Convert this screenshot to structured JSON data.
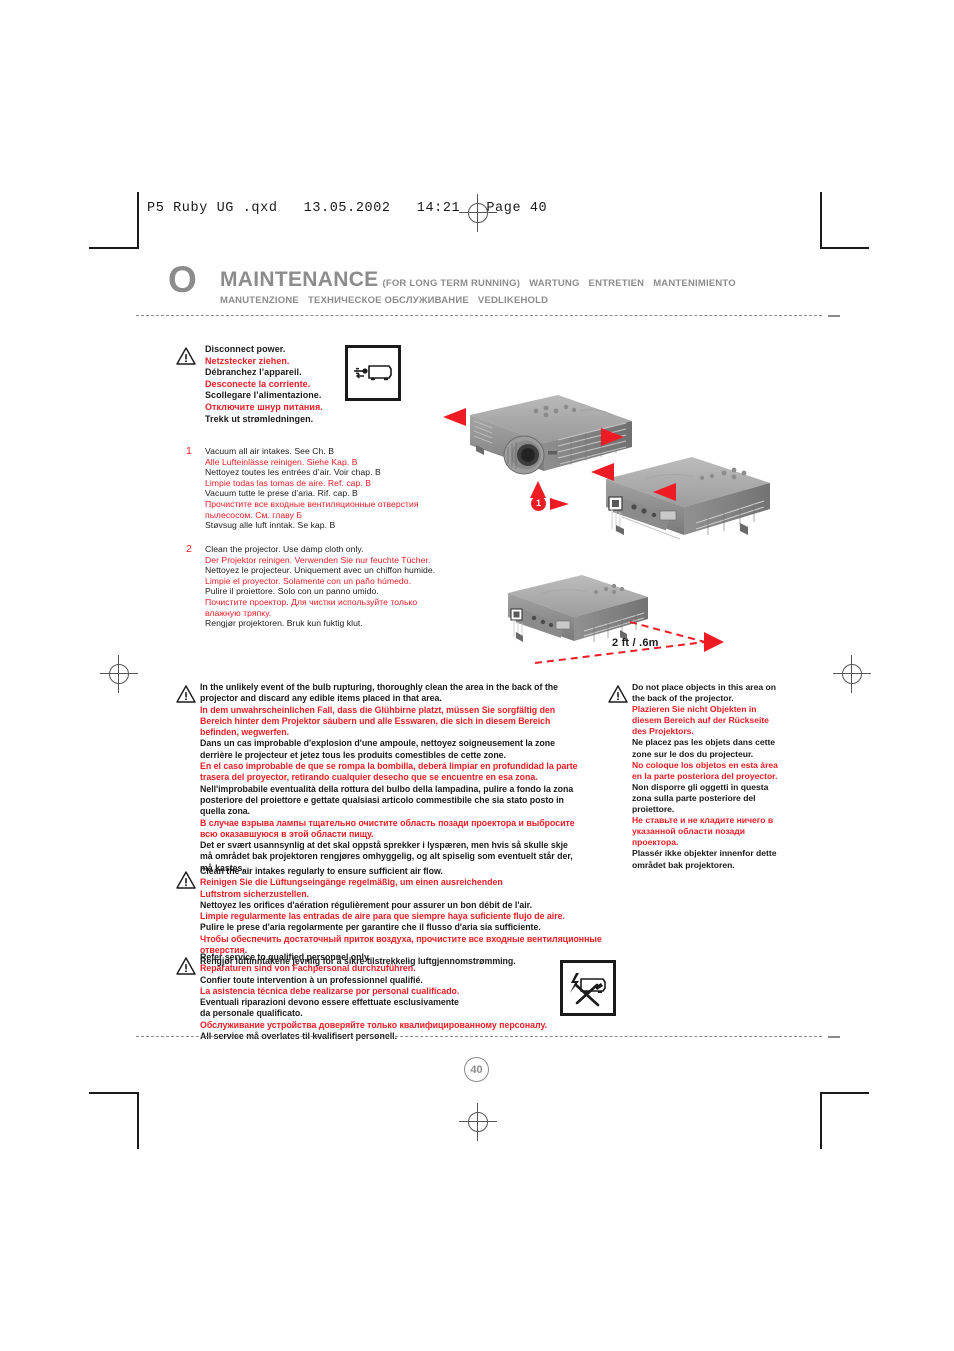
{
  "meta": {
    "slug": "P5 Ruby UG .qxd   13.05.2002   14:21   Page 40",
    "page_number": "40"
  },
  "header": {
    "section_letter": "O",
    "title": "MAINTENANCE",
    "title_paren": "(FOR LONG TERM RUNNING)",
    "langs_line1": [
      "WARTUNG",
      "ENTRETIEN",
      "MANTENIMIENTO"
    ],
    "langs_line2": [
      "MANUTENZIONE",
      "ТЕХНИЧЕСКОЕ ОБСЛУЖИВАНИЕ",
      "VEDLIKEHOLD"
    ]
  },
  "colors": {
    "red": "#ed1c24",
    "grey": "#8c8c8c",
    "black": "#1a1a1a"
  },
  "disconnect": {
    "icon": "unplug-power-icon",
    "lines": [
      {
        "text": "Disconnect power.",
        "red": false
      },
      {
        "text": "Netzstecker ziehen.",
        "red": true
      },
      {
        "text": "Débranchez l’appareil.",
        "red": false
      },
      {
        "text": "Desconecte la corriente.",
        "red": true
      },
      {
        "text": "Scollegare l’alimentazione.",
        "red": false
      },
      {
        "text": "Отключите шнур питания.",
        "red": true
      },
      {
        "text": "Trekk ut strømledningen.",
        "red": false
      }
    ]
  },
  "steps": [
    {
      "num": "1",
      "lines": [
        {
          "text": "Vacuum all air intakes. See Ch. B",
          "red": false
        },
        {
          "text": "Alle Lufteinlässe reinigen. Siehe Kap. B",
          "red": true
        },
        {
          "text": "Nettoyez toutes les entrées d’air. Voir chap. B",
          "red": false
        },
        {
          "text": "Limpie todas las tomas de aire. Ref. cap. B",
          "red": true
        },
        {
          "text": "Vacuum tutte le prese d’aria. Rif. cap. B",
          "red": false
        },
        {
          "text": "Прочистите все входные вентиляционные отверстия",
          "red": true
        },
        {
          "text": "пылесосом. См. главу Б",
          "red": true
        },
        {
          "text": "Støvsug alle luft inntak. Se kap. B",
          "red": false
        }
      ]
    },
    {
      "num": "2",
      "lines": [
        {
          "text": "Clean the projector. Use damp cloth only.",
          "red": false
        },
        {
          "text": "Der Projektor reinigen. Verwenden Sie nur feuchte Tücher.",
          "red": true
        },
        {
          "text": "Nettoyez le projecteur. Uniquement avec un chiffon humide.",
          "red": false
        },
        {
          "text": "Limpie el proyector. Solamente con un paño húmedo.",
          "red": true
        },
        {
          "text": "Pulire il proiettore. Solo con un panno umido.",
          "red": false
        },
        {
          "text": "Почистите проектор. Для чистки используйте только",
          "red": true
        },
        {
          "text": "влажную тряпку.",
          "red": true
        },
        {
          "text": "Rengjør projektoren. Bruk kun fuktig klut.",
          "red": false
        }
      ]
    }
  ],
  "illustrations": {
    "distance_label": "2 ft / .6m",
    "callout_badge": "1"
  },
  "warnings": [
    {
      "id": "bulb-rupture",
      "lines": [
        {
          "text": "In the unlikely event of the bulb rupturing, thoroughly clean the area in the back of the",
          "red": false
        },
        {
          "text": "projector and discard any edible items placed in that area.",
          "red": false
        },
        {
          "text": "In dem unwahrscheinlichen Fall, dass die Glühbirne platzt, müssen Sie sorgfältig den",
          "red": true
        },
        {
          "text": "Bereich hinter dem Projektor säubern und alle Esswaren, die sich in diesem Bereich",
          "red": true
        },
        {
          "text": "befinden, wegwerfen.",
          "red": true
        },
        {
          "text": "Dans un cas improbable d'explosion d'une ampoule, nettoyez soigneusement la zone",
          "red": false
        },
        {
          "text": "derrière le projecteur et jetez tous les produits comestibles de cette zone.",
          "red": false
        },
        {
          "text": "En el caso improbable de que se rompa la bombilla, deberá limpiar en profundidad la parte",
          "red": true
        },
        {
          "text": "trasera del proyector, retirando cualquier desecho que se encuentre en esa zona.",
          "red": true
        },
        {
          "text": "Nell'improbabile eventualità della rottura del bulbo della lampadina, pulire a fondo la zona",
          "red": false
        },
        {
          "text": "posteriore del proiettore e gettate qualsiasi articolo commestibile che sia stato posto in",
          "red": false
        },
        {
          "text": "quella zona.",
          "red": false
        },
        {
          "text": "В случае взрыва лампы тщательно очистите область позади проектора и выбросите",
          "red": true
        },
        {
          "text": "всю оказавшуюся в этой области пищу.",
          "red": true
        },
        {
          "text": "Det er svært usannsynlig at det skal oppstå sprekker i lyspæren, men hvis så skulle skje",
          "red": false
        },
        {
          "text": "må området bak projektoren rengjøres omhyggelig, og alt spiselig som eventuelt står der,",
          "red": false
        },
        {
          "text": "må kastes.",
          "red": false
        }
      ]
    },
    {
      "id": "no-objects-behind",
      "lines": [
        {
          "text": "Do not place objects in this area on",
          "red": false
        },
        {
          "text": "the back of the projector.",
          "red": false
        },
        {
          "text": "Plazieren Sie nicht Objekten in",
          "red": true
        },
        {
          "text": "diesem Bereich auf der Rückseite",
          "red": true
        },
        {
          "text": "des Projektors.",
          "red": true
        },
        {
          "text": "Ne placez pas les objets dans cette",
          "red": false
        },
        {
          "text": "zone sur le dos du projecteur.",
          "red": false
        },
        {
          "text": "No coloque los objetos en esta área",
          "red": true
        },
        {
          "text": "en la parte posteriora del proyector.",
          "red": true
        },
        {
          "text": "Non disporre gli oggetti in questa",
          "red": false
        },
        {
          "text": "zona sulla parte posteriore del",
          "red": false
        },
        {
          "text": "proiettore.",
          "red": false
        },
        {
          "text": "Не ставьте и не кладите ничего в",
          "red": true
        },
        {
          "text": "указанной области позади",
          "red": true
        },
        {
          "text": "проектора.",
          "red": true
        },
        {
          "text": "Plassér ikke objekter innenfor dette",
          "red": false
        },
        {
          "text": "området bak projektoren.",
          "red": false
        }
      ]
    },
    {
      "id": "clean-air-intakes",
      "lines": [
        {
          "text": "Clean the air intakes regularly to ensure sufficient air flow.",
          "red": false
        },
        {
          "text": "Reinigen Sie die Lüftungseingänge regelmäßig, um einen ausreichenden",
          "red": true
        },
        {
          "text": "Luftstrom sicherzustellen.",
          "red": true
        },
        {
          "text": "Nettoyez les orifices d'aération régulièrement pour assurer un bon débit de l'air.",
          "red": false
        },
        {
          "text": "Limpie regularmente las entradas de aire para que siempre haya suficiente flujo de aire.",
          "red": true
        },
        {
          "text": "Pulire le prese d'aria regolarmente per garantire che il flusso d'aria sia sufficiente.",
          "red": false
        },
        {
          "text": "Чтобы обеспечить достаточный приток воздуха, прочистите все входные вентиляционные отверстия.",
          "red": true
        },
        {
          "text": "Rengjør luftinntakene jevnlig for å sikre tilstrekkelig luftgjennomstrømming.",
          "red": false
        }
      ]
    },
    {
      "id": "qualified-service",
      "icon": "no-service-shock-icon",
      "lines": [
        {
          "text": "Refer service to qualified personnel only.",
          "red": false
        },
        {
          "text": "Reparaturen sind von Fachpersonal durchzuführen.",
          "red": true
        },
        {
          "text": "Confier toute intervention à un professionnel qualifié.",
          "red": false
        },
        {
          "text": "La asistencia técnica debe realizarse por personal cualificado.",
          "red": true
        },
        {
          "text": "Eventuali riparazioni devono essere effettuate esclusivamente",
          "red": false
        },
        {
          "text": "da personale qualificato.",
          "red": false
        },
        {
          "text": "Обслуживание устройства доверяйте только квалифицированному персоналу.",
          "red": true
        },
        {
          "text": "All service må overlates til kvalifisert personell.",
          "red": false
        }
      ]
    }
  ]
}
